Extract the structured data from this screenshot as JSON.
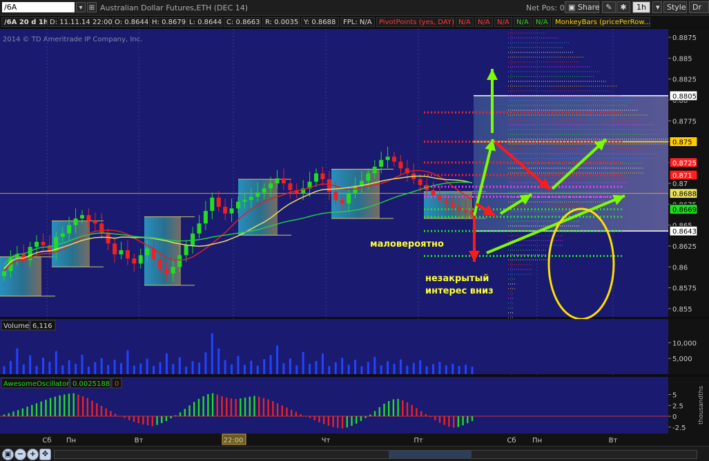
{
  "toolbar": {
    "symbol": "/6A",
    "description": "Australian Dollar Futures,ETH (DEC 14)",
    "net_pos": "Net Pos: 0",
    "share_label": "Share",
    "timeframe_label": "1h",
    "style_label": "Style",
    "draw_label": "Dr"
  },
  "infobar": {
    "symbol_period": "/6A 20 d 1h",
    "date": "D: 11.11.14 22:00",
    "open": "O: 0.8644",
    "high": "H: 0.8679",
    "low": "L: 0.8644",
    "close": "C: 0.8663",
    "range": "R: 0.0035",
    "y": "Y: 0.8688",
    "fpl": "FPL: N/A",
    "pivot": "PivotPoints (yes, DAY)",
    "na1": "N/A",
    "na2": "N/A",
    "na3": "N/A",
    "na4": "N/A",
    "na5": "N/A",
    "monkeybars": "MonkeyBars (pricePerRow..."
  },
  "copyright": "2014 © TD Ameritrade IP Company, Inc.",
  "annotations": {
    "unlikely": "маловероятно",
    "unfilled_line1": "незакрытый",
    "unfilled_line2": "интерес вниз"
  },
  "colors": {
    "background": "#1a1a70",
    "up_candle": "#22dd22",
    "down_candle": "#ee2222",
    "volume_bar": "#2244ff",
    "ma_yellow": "#e8e060",
    "ma_green": "#22cc44",
    "ma_red": "#dd2222",
    "pivot_red": "#ff2020",
    "pivot_green": "#22dd22",
    "pivot_magenta": "#ff33ff",
    "annotation_text": "#ffff33",
    "arrow_green": "#7cfc00",
    "arrow_red": "#ff1a1a",
    "ellipse": "#ffe000"
  },
  "chart_data": [
    {
      "type": "candlestick",
      "title": "/6A 20 d 1h",
      "price_axis_ticks": [
        "0.8875",
        "0.885",
        "0.8825",
        "0.88",
        "0.8775",
        "0.875",
        "0.8725",
        "0.87",
        "0.8675",
        "0.865",
        "0.8625",
        "0.86",
        "0.8575",
        "0.855"
      ],
      "ylim": [
        0.854,
        0.8885
      ],
      "x_ticks": [
        "Сб",
        "Пн",
        "Вт",
        "22:00",
        "Чт",
        "Пт",
        "Сб",
        "Пн",
        "Вт"
      ],
      "price_markers": [
        {
          "value": "0.8805",
          "color": "#ffffff"
        },
        {
          "value": "0.875",
          "color": "#ffcc00"
        },
        {
          "value": "0.8725",
          "color": "#ff2020"
        },
        {
          "value": "0.871",
          "color": "#ff2020"
        },
        {
          "value": "0.8688",
          "color": "#e8e060"
        },
        {
          "value": "0.8669",
          "color": "#22dd22"
        },
        {
          "value": "0.8643",
          "color": "#ffffff"
        }
      ],
      "pivot_levels": {
        "red": [
          0.8785,
          0.875,
          0.8725,
          0.871
        ],
        "magenta": [
          0.8696,
          0.8684
        ],
        "green": [
          0.8669,
          0.866,
          0.8643,
          0.8613
        ]
      },
      "close_series": [
        0.8595,
        0.8612,
        0.8615,
        0.8608,
        0.8624,
        0.863,
        0.8626,
        0.8618,
        0.8636,
        0.864,
        0.865,
        0.8658,
        0.8662,
        0.8655,
        0.8652,
        0.864,
        0.8628,
        0.8615,
        0.862,
        0.861,
        0.8604,
        0.8614,
        0.8622,
        0.8609,
        0.8598,
        0.8592,
        0.86,
        0.8614,
        0.8626,
        0.864,
        0.8652,
        0.8667,
        0.8683,
        0.8672,
        0.8664,
        0.867,
        0.8678,
        0.868,
        0.8684,
        0.8689,
        0.8694,
        0.87,
        0.8706,
        0.87,
        0.8692,
        0.8688,
        0.8694,
        0.8702,
        0.8712,
        0.8705,
        0.869,
        0.868,
        0.8676,
        0.8688,
        0.8697,
        0.8703,
        0.8712,
        0.872,
        0.8728,
        0.8732,
        0.8726,
        0.8718,
        0.8712,
        0.8705,
        0.8698,
        0.8692,
        0.8686,
        0.868,
        0.8677,
        0.8672,
        0.8668,
        0.8666,
        0.8663
      ]
    },
    {
      "type": "bar",
      "title": "Volume",
      "value_label": "6,116",
      "ylim": [
        0,
        14000
      ],
      "y_ticks": [
        "10,000",
        "5,000"
      ],
      "values": [
        2500,
        4200,
        8200,
        3100,
        6000,
        2600,
        5200,
        3900,
        7300,
        2800,
        4400,
        3300,
        6200,
        2400,
        3800,
        5100,
        2900,
        4600,
        3500,
        7600,
        2700,
        3400,
        4900,
        2600,
        3800,
        6600,
        3200,
        5400,
        2400,
        4100,
        3700,
        6900,
        13000,
        8200,
        4500,
        3100,
        5800,
        3000,
        4300,
        2700,
        4800,
        6100,
        9100,
        3500,
        5000,
        2800,
        7000,
        3300,
        4200,
        6600,
        2600,
        3800,
        5200,
        3000,
        4600,
        2500,
        3900,
        5500,
        2800,
        4100,
        3300,
        4700,
        2700,
        3600,
        4400,
        2500,
        3200,
        3900,
        2800,
        3300,
        2600,
        3000,
        2400
      ]
    },
    {
      "type": "bar",
      "title": "AwesomeOscillator",
      "value_label": "0.0025188",
      "value_label_2": "0",
      "ylim": [
        -0.0038,
        0.0062
      ],
      "y_ticks": [
        "5",
        "2.5",
        "0",
        "-2.5"
      ],
      "y_axis_label": "thousandths",
      "values": [
        0.4,
        0.7,
        1.1,
        1.4,
        1.8,
        2.2,
        2.6,
        3.0,
        3.4,
        3.8,
        4.2,
        4.5,
        4.8,
        5.0,
        5.2,
        5.3,
        5.0,
        4.6,
        4.2,
        3.6,
        3.0,
        2.4,
        1.8,
        1.2,
        0.6,
        0.1,
        -0.4,
        -0.9,
        -1.3,
        -1.6,
        -1.9,
        -2.1,
        -2.3,
        -2.0,
        -1.6,
        -1.1,
        -0.5,
        0.2,
        0.9,
        1.7,
        2.5,
        3.3,
        4.0,
        4.6,
        5.1,
        5.3,
        5.0,
        4.6,
        4.3,
        4.1,
        4.0,
        4.1,
        4.3,
        4.5,
        4.7,
        4.5,
        4.2,
        3.9,
        3.5,
        3.0,
        2.5,
        2.0,
        1.5,
        1.0,
        0.5,
        0.1,
        -0.4,
        -0.9,
        -1.4,
        -1.8,
        -2.2,
        -2.5,
        -2.7,
        -2.8,
        -2.6,
        -2.2,
        -1.7,
        -1.1,
        -0.4,
        0.4,
        1.2,
        2.1,
        2.9,
        3.5,
        3.9,
        4.0,
        3.7,
        3.2,
        2.6,
        1.9,
        1.2,
        0.5,
        -0.2,
        -0.9,
        -1.5,
        -2.0,
        -2.4,
        -2.6,
        -2.5,
        -2.1,
        -1.6,
        -1.1
      ]
    }
  ]
}
